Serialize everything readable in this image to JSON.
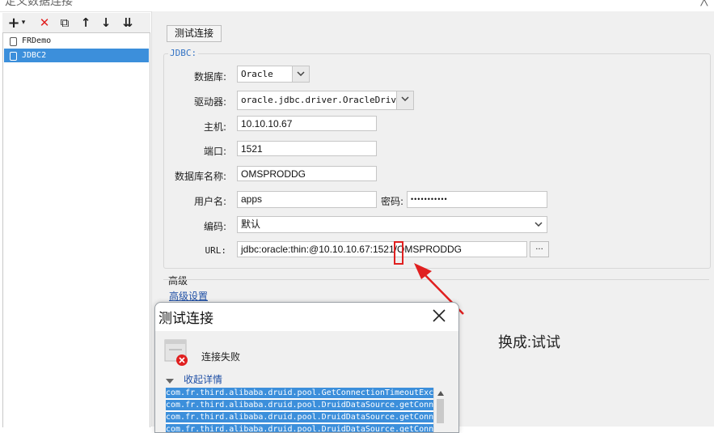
{
  "window": {
    "title": "定义数据连接",
    "close_glyph": "╳"
  },
  "toolbar": {
    "add_glyph": "+",
    "add_caret": "▾",
    "delete_glyph": "✕",
    "copy_glyph": "⧉",
    "up_glyph": "↑",
    "down_glyph": "↓",
    "sort_glyph": "⇊"
  },
  "tree": {
    "items": [
      {
        "label": "FRDemo"
      },
      {
        "label": "JDBC2"
      }
    ],
    "selected": "JDBC2"
  },
  "test_button_label": "测试连接",
  "jdbc": {
    "group_label": "JDBC:",
    "database_label": "数据库:",
    "database_value": "Oracle",
    "driver_label": "驱动器:",
    "driver_value": "oracle.jdbc.driver.OracleDriver",
    "host_label": "主机:",
    "host_value": "10.10.10.67",
    "port_label": "端口:",
    "port_value": "1521",
    "dbname_label": "数据库名称:",
    "dbname_value": "OMSPRODDG",
    "username_label": "用户名:",
    "username_value": "apps",
    "password_label": "密码:",
    "password_value": "•••••••••••",
    "encoding_label": "编码:",
    "encoding_value": "默认",
    "url_label": "URL:",
    "url_value": "jdbc:oracle:thin:@10.10.10.67:1521/OMSPRODDG",
    "url_button": "..."
  },
  "advanced": {
    "title": "高级",
    "link": "高级设置"
  },
  "annotation": {
    "note": "换成:试试",
    "color": "#e02020"
  },
  "dialog": {
    "title": "测试连接",
    "status": "连接失败",
    "toggle": "收起详情",
    "details": [
      "com.fr.third.alibaba.druid.pool.GetConnectionTimeoutExc",
      "com.fr.third.alibaba.druid.pool.DruidDataSource.getConn",
      "com.fr.third.alibaba.druid.pool.DruidDataSource.getConn",
      "com.fr.third.alibaba.druid.pool.DruidDataSource.getConn"
    ]
  },
  "colors": {
    "accent": "#3c8fdb",
    "error": "#e02020",
    "link": "#1f4fa5",
    "group_title": "#3373c4"
  }
}
